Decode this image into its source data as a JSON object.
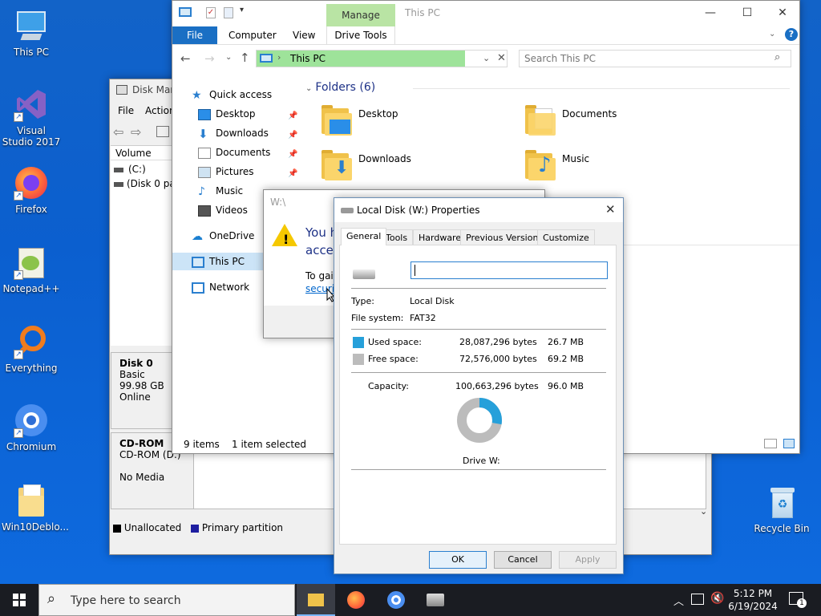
{
  "desktop": {
    "icons": [
      {
        "label": "This PC"
      },
      {
        "label": "Visual Studio 2017"
      },
      {
        "label": "Firefox"
      },
      {
        "label": "Notepad++"
      },
      {
        "label": "Everything"
      },
      {
        "label": "Chromium"
      },
      {
        "label": "Win10Deblo..."
      },
      {
        "label": "Recycle Bin"
      }
    ]
  },
  "disk_mgmt": {
    "title": "Disk Man",
    "menu": [
      "File",
      "Action"
    ],
    "columns": {
      "volume": "Volume"
    },
    "volumes": [
      "(C:)",
      "(Disk 0 par"
    ],
    "disk0": {
      "name": "Disk 0",
      "type": "Basic",
      "size": "99.98 GB",
      "status": "Online"
    },
    "cdrom": {
      "name": "CD-ROM",
      "drive": "CD-ROM (D:)",
      "media": "No Media"
    },
    "legend": {
      "unallocated": "Unallocated",
      "primary": "Primary partition"
    }
  },
  "explorer": {
    "title": "This PC",
    "manage_tab": "Manage",
    "tabs": {
      "file": "File",
      "computer": "Computer",
      "view": "View",
      "drive_tools": "Drive Tools"
    },
    "address": "This PC",
    "search_placeholder": "Search This PC",
    "nav": {
      "quick_access": "Quick access",
      "desktop": "Desktop",
      "downloads": "Downloads",
      "documents": "Documents",
      "pictures": "Pictures",
      "music": "Music",
      "videos": "Videos",
      "onedrive": "OneDrive",
      "this_pc": "This PC",
      "network": "Network"
    },
    "folders_header": "Folders (6)",
    "folders": {
      "desktop": "Desktop",
      "documents": "Documents",
      "downloads": "Downloads",
      "music": "Music"
    },
    "status": {
      "items": "9 items",
      "selected": "1 item selected"
    }
  },
  "access_dialog": {
    "title": "W:\\",
    "heading": "You h",
    "heading2": "acces",
    "text": "To gair",
    "link": "securi"
  },
  "properties": {
    "title": "Local Disk (W:) Properties",
    "tabs": {
      "general": "General",
      "tools": "Tools",
      "hardware": "Hardware",
      "previous": "Previous Versions",
      "customize": "Customize"
    },
    "name_value": "",
    "type_label": "Type:",
    "type_value": "Local Disk",
    "fs_label": "File system:",
    "fs_value": "FAT32",
    "used_label": "Used space:",
    "used_bytes": "28,087,296 bytes",
    "used_mb": "26.7 MB",
    "free_label": "Free space:",
    "free_bytes": "72,576,000 bytes",
    "free_mb": "69.2 MB",
    "capacity_label": "Capacity:",
    "capacity_bytes": "100,663,296 bytes",
    "capacity_mb": "96.0 MB",
    "drive_label": "Drive W:",
    "used_fraction": 0.279,
    "used_color": "#26a0da",
    "free_color": "#bcbcbc",
    "ok": "OK",
    "cancel": "Cancel",
    "apply": "Apply"
  },
  "taskbar": {
    "search_placeholder": "Type here to search",
    "time": "5:12 PM",
    "date": "6/19/2024",
    "notif_count": "1"
  }
}
